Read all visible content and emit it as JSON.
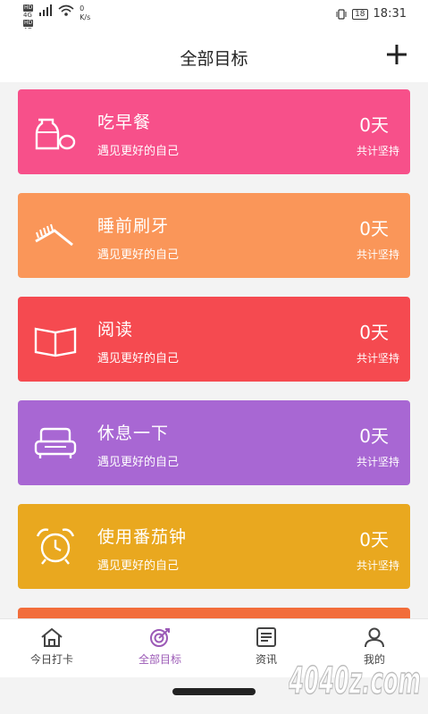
{
  "status_bar": {
    "hd1": "HD",
    "sig1": "4G",
    "hd2": "HD",
    "sig2": "4G",
    "net_speed_value": "0",
    "net_speed_unit": "K/s",
    "battery": "18",
    "time": "18:31"
  },
  "header": {
    "title": "全部目标"
  },
  "goals": [
    {
      "name": "吃早餐",
      "slogan": "遇见更好的自己",
      "days": "0天",
      "persist": "共计坚持",
      "color": "#f7508a",
      "icon": "bottle-egg-icon"
    },
    {
      "name": "睡前刷牙",
      "slogan": "遇见更好的自己",
      "days": "0天",
      "persist": "共计坚持",
      "color": "#fa9659",
      "icon": "toothbrush-icon"
    },
    {
      "name": "阅读",
      "slogan": "遇见更好的自己",
      "days": "0天",
      "persist": "共计坚持",
      "color": "#f54a50",
      "icon": "book-icon"
    },
    {
      "name": "休息一下",
      "slogan": "遇见更好的自己",
      "days": "0天",
      "persist": "共计坚持",
      "color": "#a867d3",
      "icon": "sofa-icon"
    },
    {
      "name": "使用番茄钟",
      "slogan": "遇见更好的自己",
      "days": "0天",
      "persist": "共计坚持",
      "color": "#e9a81f",
      "icon": "alarm-clock-icon"
    }
  ],
  "tabs": [
    {
      "label": "今日打卡",
      "icon": "home-icon",
      "active": false
    },
    {
      "label": "全部目标",
      "icon": "target-icon",
      "active": true
    },
    {
      "label": "资讯",
      "icon": "news-icon",
      "active": false
    },
    {
      "label": "我的",
      "icon": "user-icon",
      "active": false
    }
  ],
  "colors": {
    "accent": "#9b59b6",
    "peek_card": "#f26d3a"
  },
  "watermark": "4040z.com"
}
